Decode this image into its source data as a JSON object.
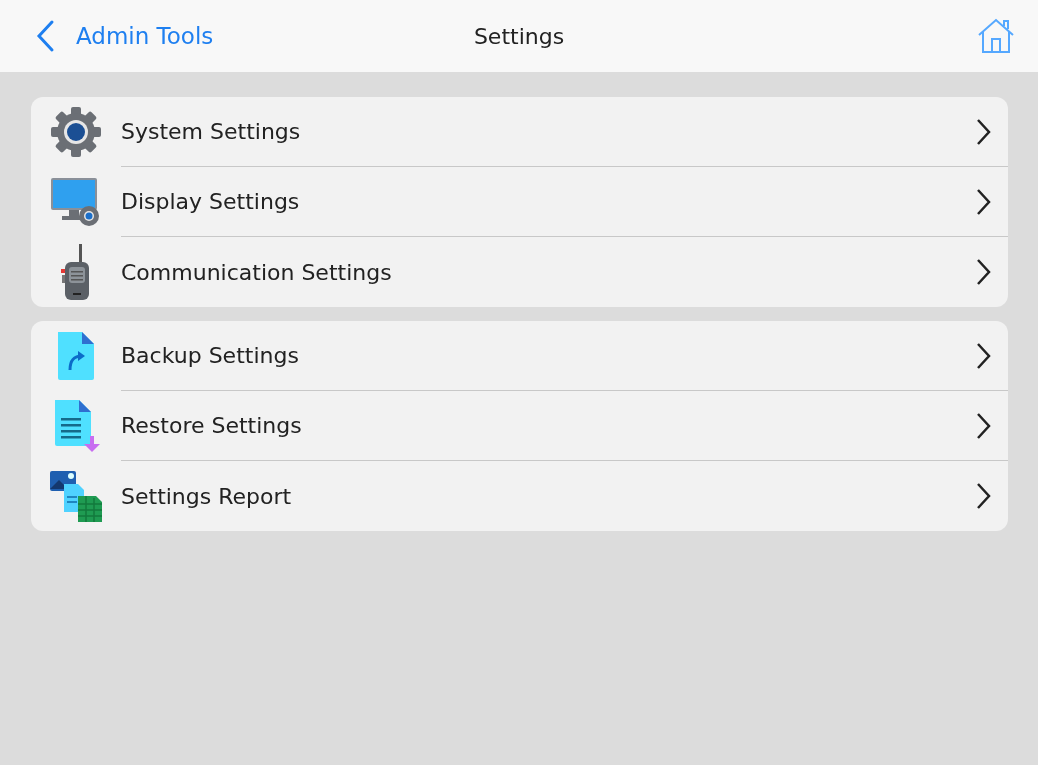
{
  "header": {
    "back_label": "Admin Tools",
    "title": "Settings"
  },
  "groups": [
    {
      "items": [
        {
          "label": "System Settings",
          "kind": "gear"
        },
        {
          "label": "Display Settings",
          "kind": "monitor"
        },
        {
          "label": "Communication Settings",
          "kind": "radio"
        }
      ]
    },
    {
      "items": [
        {
          "label": "Backup Settings",
          "kind": "backup"
        },
        {
          "label": "Restore Settings",
          "kind": "restore"
        },
        {
          "label": "Settings Report",
          "kind": "report"
        }
      ]
    }
  ]
}
